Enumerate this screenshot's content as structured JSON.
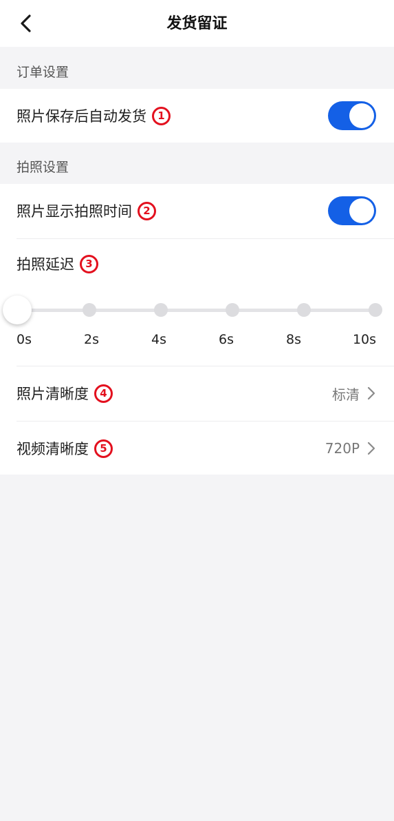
{
  "header": {
    "title": "发货留证",
    "back_icon": "chevron-left-icon"
  },
  "sections": {
    "order": {
      "label": "订单设置",
      "auto_ship": {
        "label": "照片保存后自动发货",
        "badge": "1",
        "enabled": true
      }
    },
    "photo": {
      "label": "拍照设置",
      "show_time": {
        "label": "照片显示拍照时间",
        "badge": "2",
        "enabled": true
      },
      "delay": {
        "label": "拍照延迟",
        "badge": "3",
        "ticks": [
          "0s",
          "2s",
          "4s",
          "6s",
          "8s",
          "10s"
        ],
        "selected": "0s"
      },
      "photo_quality": {
        "label": "照片清晰度",
        "badge": "4",
        "value": "标清"
      },
      "video_quality": {
        "label": "视频清晰度",
        "badge": "5",
        "value": "720P"
      }
    }
  },
  "colors": {
    "accent": "#1460e6",
    "badge": "#e3101e",
    "background": "#f4f4f6"
  }
}
